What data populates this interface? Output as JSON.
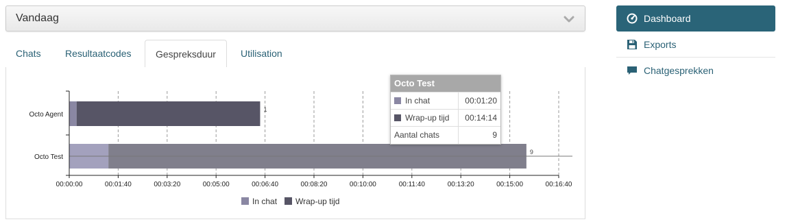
{
  "period": {
    "label": "Vandaag",
    "icon": "chevron-down-icon"
  },
  "tabs": [
    {
      "label": "Chats",
      "active": false
    },
    {
      "label": "Resultaatcodes",
      "active": false
    },
    {
      "label": "Gespreksduur",
      "active": true
    },
    {
      "label": "Utilisation",
      "active": false
    }
  ],
  "nav": {
    "items": [
      {
        "label": "Dashboard",
        "icon": "dashboard-gauge-icon",
        "active": true
      },
      {
        "label": "Exports",
        "icon": "floppy-disk-icon",
        "active": false
      },
      {
        "label": "Chatgesprekken",
        "icon": "chat-bubble-icon",
        "active": false
      }
    ]
  },
  "colors": {
    "in_chat": "#8a87a3",
    "wrap_up": "#575566",
    "in_chat_hover": "#a3a1bd",
    "wrap_up_hover": "#807f8c",
    "nav_active": "#2a6478",
    "link": "#2a6175"
  },
  "chart_data": {
    "type": "bar",
    "orientation": "horizontal",
    "stacked": true,
    "categories": [
      "Octo Agent",
      "Octo Test"
    ],
    "series": [
      {
        "name": "In chat",
        "values": [
          15,
          80
        ]
      },
      {
        "name": "Wrap-up tijd",
        "values": [
          375,
          854
        ]
      }
    ],
    "data_labels": [
      "1",
      "9"
    ],
    "x_tick_labels": [
      "00:00:00",
      "00:01:40",
      "00:03:20",
      "00:05:00",
      "00:06:40",
      "00:08:20",
      "00:10:00",
      "00:11:40",
      "00:13:20",
      "00:15:00",
      "00:16:40"
    ],
    "x_ticks": [
      0,
      100,
      200,
      300,
      400,
      500,
      600,
      700,
      800,
      900,
      1000
    ],
    "xlim": [
      0,
      1000
    ],
    "x_unit": "seconds",
    "hovered_category": "Octo Test",
    "grid": "vertical dashed",
    "legend": "bottom-center"
  },
  "tooltip": {
    "title": "Octo Test",
    "rows": [
      {
        "label": "In chat",
        "value": "00:01:20"
      },
      {
        "label": "Wrap-up tijd",
        "value": "00:14:14"
      },
      {
        "label": "Aantal chats",
        "value": "9"
      }
    ]
  }
}
